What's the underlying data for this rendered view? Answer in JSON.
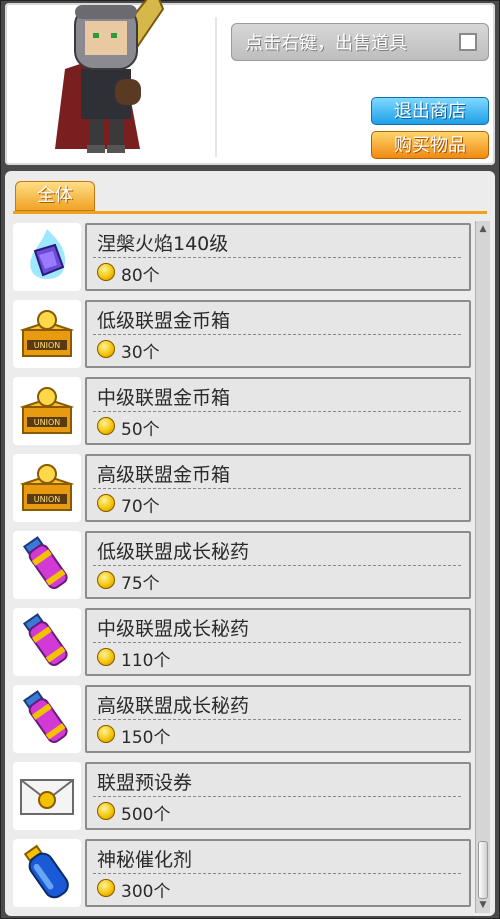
{
  "header": {
    "sell_tip_label": "点击右键，出售道具",
    "exit_button_label": "退出商店",
    "buy_button_label": "购买物品"
  },
  "tabs": [
    {
      "label": "全体",
      "selected": true
    }
  ],
  "items": [
    {
      "name": "涅槃火焰140级",
      "price": "80个",
      "icon": "blue-flame-crystal-icon"
    },
    {
      "name": "低级联盟金币箱",
      "price": "30个",
      "icon": "union-coin-box-icon"
    },
    {
      "name": "中级联盟金币箱",
      "price": "50个",
      "icon": "union-coin-box-icon"
    },
    {
      "name": "高级联盟金币箱",
      "price": "70个",
      "icon": "union-coin-box-icon"
    },
    {
      "name": "低级联盟成长秘药",
      "price": "75个",
      "icon": "purple-potion-vial-icon"
    },
    {
      "name": "中级联盟成长秘药",
      "price": "110个",
      "icon": "purple-potion-vial-icon"
    },
    {
      "name": "高级联盟成长秘药",
      "price": "150个",
      "icon": "purple-potion-vial-icon"
    },
    {
      "name": "联盟预设券",
      "price": "500个",
      "icon": "union-voucher-envelope-icon"
    },
    {
      "name": "神秘催化剂",
      "price": "300个",
      "icon": "blue-catalyst-vial-icon"
    }
  ],
  "colors": {
    "exit_button": "#1f9fe8",
    "buy_button": "#f08a12",
    "tab_active": "#f0a020",
    "coin": "#f2c200"
  }
}
